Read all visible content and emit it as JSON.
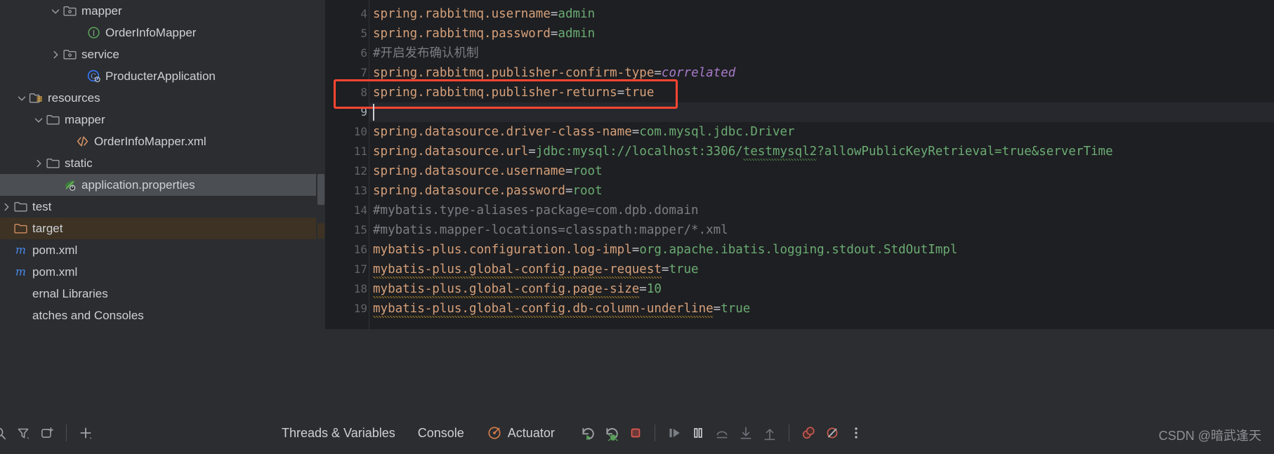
{
  "sidebar": {
    "name": "project-tool-window",
    "items": [
      {
        "label": "mapper",
        "indent": 70,
        "chevron": "down",
        "icon": "package-folder-icon",
        "state": "normal",
        "clipped": false
      },
      {
        "label": "OrderInfoMapper",
        "indent": 104,
        "chevron": "none",
        "icon": "java-interface-icon",
        "state": "normal",
        "clipped": false
      },
      {
        "label": "service",
        "indent": 70,
        "chevron": "right",
        "icon": "package-folder-icon",
        "state": "normal",
        "clipped": false
      },
      {
        "label": "ProducterApplication",
        "indent": 104,
        "chevron": "none",
        "icon": "spring-class-icon",
        "state": "normal",
        "clipped": false
      },
      {
        "label": "resources",
        "indent": 22,
        "chevron": "down",
        "icon": "resources-folder-icon",
        "state": "normal",
        "clipped": false
      },
      {
        "label": "mapper",
        "indent": 46,
        "chevron": "down",
        "icon": "folder-icon",
        "state": "normal",
        "clipped": false
      },
      {
        "label": "OrderInfoMapper.xml",
        "indent": 88,
        "chevron": "none",
        "icon": "xml-file-icon",
        "state": "normal",
        "clipped": false
      },
      {
        "label": "static",
        "indent": 46,
        "chevron": "right",
        "icon": "folder-icon",
        "state": "normal",
        "clipped": false
      },
      {
        "label": "application.properties",
        "indent": 70,
        "chevron": "none",
        "icon": "spring-properties-icon",
        "state": "selected",
        "clipped": false
      },
      {
        "label": "test",
        "indent": -4,
        "chevron": "right",
        "icon": "folder-icon",
        "state": "normal",
        "clipped": true
      },
      {
        "label": "target",
        "indent": -22,
        "chevron": "none",
        "icon": "excluded-folder-icon",
        "state": "target",
        "clipped": true
      },
      {
        "label": "pom.xml",
        "indent": -16,
        "chevron": "none",
        "icon": "maven-file-icon",
        "state": "normal",
        "clipped": true
      },
      {
        "label": "pom.xml",
        "indent": -38,
        "chevron": "none",
        "icon": "maven-file-icon",
        "state": "normal",
        "clipped": true
      },
      {
        "label": "ernal Libraries",
        "indent": -38,
        "chevron": "none",
        "icon": "none",
        "state": "normal",
        "clipped": true
      },
      {
        "label": "atches and Consoles",
        "indent": -38,
        "chevron": "none",
        "icon": "none",
        "state": "normal",
        "clipped": true
      }
    ]
  },
  "editor": {
    "name": "application-properties-editor",
    "file": "application.properties",
    "first_visible_line": 4,
    "caret_line": 9,
    "highlight_line": 8,
    "lines": [
      {
        "num": 4,
        "segments": [
          {
            "t": "spring.rabbitmq.username",
            "c": "k"
          },
          {
            "t": "=",
            "c": "eq"
          },
          {
            "t": "admin",
            "c": "v"
          }
        ]
      },
      {
        "num": 5,
        "segments": [
          {
            "t": "spring.rabbitmq.password",
            "c": "k"
          },
          {
            "t": "=",
            "c": "eq"
          },
          {
            "t": "admin",
            "c": "v"
          }
        ]
      },
      {
        "num": 6,
        "segments": [
          {
            "t": "#开启发布确认机制",
            "c": "cm"
          }
        ]
      },
      {
        "num": 7,
        "segments": [
          {
            "t": "spring.rabbitmq.publisher-confirm-type",
            "c": "k"
          },
          {
            "t": "=",
            "c": "eq"
          },
          {
            "t": "correlated",
            "c": "vp"
          }
        ]
      },
      {
        "num": 8,
        "segments": [
          {
            "t": "spring.rabbitmq.publisher-returns",
            "c": "k"
          },
          {
            "t": "=",
            "c": "eq"
          },
          {
            "t": "true",
            "c": "k"
          }
        ]
      },
      {
        "num": 9,
        "segments": []
      },
      {
        "num": 10,
        "segments": [
          {
            "t": "spring.datasource.driver-class-name",
            "c": "k"
          },
          {
            "t": "=",
            "c": "eq"
          },
          {
            "t": "com.mysql.jdbc.Driver",
            "c": "v"
          }
        ]
      },
      {
        "num": 11,
        "segments": [
          {
            "t": "spring.datasource.url",
            "c": "k"
          },
          {
            "t": "=",
            "c": "eq"
          },
          {
            "t": "jdbc:mysql://localhost:3306/",
            "c": "v"
          },
          {
            "t": "testmysql2",
            "c": "v greensq"
          },
          {
            "t": "?allowPublicKeyRetrieval=true&serverTime",
            "c": "v"
          }
        ]
      },
      {
        "num": 12,
        "segments": [
          {
            "t": "spring.datasource.username",
            "c": "k"
          },
          {
            "t": "=",
            "c": "eq"
          },
          {
            "t": "root",
            "c": "v"
          }
        ]
      },
      {
        "num": 13,
        "segments": [
          {
            "t": "spring.datasource.password",
            "c": "k"
          },
          {
            "t": "=",
            "c": "eq"
          },
          {
            "t": "root",
            "c": "v"
          }
        ]
      },
      {
        "num": 14,
        "segments": [
          {
            "t": "#mybatis.type-aliases-package=com.dpb.domain",
            "c": "cm"
          }
        ]
      },
      {
        "num": 15,
        "segments": [
          {
            "t": "#mybatis.mapper-locations=classpath:mapper/*.xml",
            "c": "cm"
          }
        ]
      },
      {
        "num": 16,
        "segments": [
          {
            "t": "mybatis-plus.configuration.log-impl",
            "c": "k"
          },
          {
            "t": "=",
            "c": "eq"
          },
          {
            "t": "org.apache.ibatis.logging.stdout.StdOutImpl",
            "c": "v"
          }
        ]
      },
      {
        "num": 17,
        "segments": [
          {
            "t": "mybatis-plus.global-config.page-request",
            "c": "k warnsq"
          },
          {
            "t": "=",
            "c": "eq"
          },
          {
            "t": "true",
            "c": "v"
          }
        ]
      },
      {
        "num": 18,
        "segments": [
          {
            "t": "mybatis-plus.global-config.page-size",
            "c": "k warnsq"
          },
          {
            "t": "=",
            "c": "eq"
          },
          {
            "t": "10",
            "c": "v"
          }
        ]
      },
      {
        "num": 19,
        "segments": [
          {
            "t": "mybatis-plus.global-config.db-column-underline",
            "c": "k warnsq"
          },
          {
            "t": "=",
            "c": "eq"
          },
          {
            "t": "true",
            "c": "v"
          }
        ]
      }
    ]
  },
  "toolbar": {
    "left_icons": [
      {
        "name": "search-icon",
        "glyph": "search"
      },
      {
        "name": "filter-icon",
        "glyph": "filter"
      },
      {
        "name": "new-tab-icon",
        "glyph": "newtab"
      },
      {
        "name": "add-icon",
        "glyph": "plus"
      }
    ],
    "tabs": [
      {
        "label": "Threads & Variables",
        "icon": "none",
        "active": false
      },
      {
        "label": "Console",
        "icon": "none",
        "active": false
      },
      {
        "label": "Actuator",
        "icon": "actuator-icon",
        "active": false
      }
    ],
    "debug_controls": [
      {
        "name": "rerun-button",
        "glyph": "rerun"
      },
      {
        "name": "rerun-debug-button",
        "glyph": "rerun-debug"
      },
      {
        "name": "stop-button",
        "glyph": "stop"
      },
      {
        "name": "resume-program-button",
        "glyph": "resume"
      },
      {
        "name": "pause-program-button",
        "glyph": "pause"
      },
      {
        "name": "step-over-button",
        "glyph": "step-over"
      },
      {
        "name": "step-into-button",
        "glyph": "step-into"
      },
      {
        "name": "step-out-button",
        "glyph": "step-out"
      },
      {
        "name": "view-breakpoints-button",
        "glyph": "breakpoints"
      },
      {
        "name": "mute-breakpoints-button",
        "glyph": "mute"
      },
      {
        "name": "more-options-button",
        "glyph": "more"
      }
    ]
  },
  "watermark": {
    "text": "CSDN @暗武逢天"
  },
  "colors": {
    "sidebar_bg": "#2b2d30",
    "editor_bg": "#1e1f22",
    "selection_bg": "#4b4f54",
    "excluded_bg": "#3d3223",
    "highlight_box": "#ff4632",
    "key": "#d6a07a",
    "value": "#6aab73",
    "comment": "#7a7e85",
    "placeholder": "#a77bca"
  }
}
